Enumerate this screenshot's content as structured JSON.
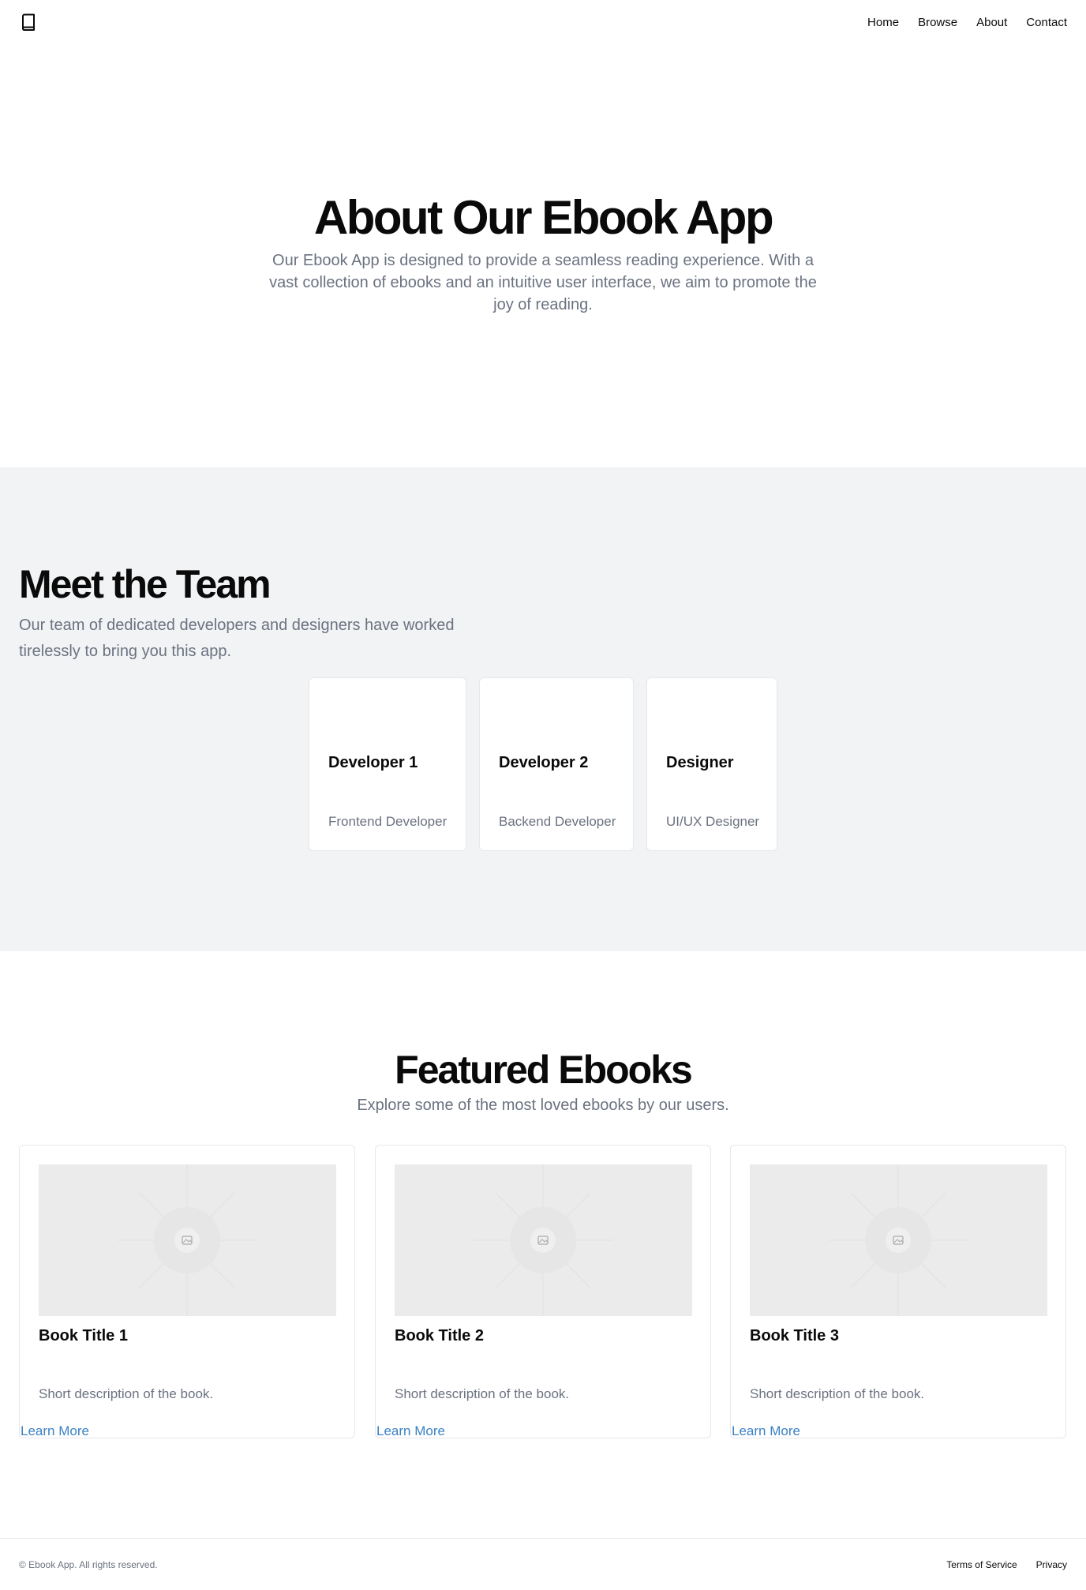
{
  "header": {
    "logo_icon": "book-icon",
    "nav": [
      "Home",
      "Browse",
      "About",
      "Contact"
    ]
  },
  "hero": {
    "title": "About Our Ebook App",
    "description": "Our Ebook App is designed to provide a seamless reading experience. With a vast collection of ebooks and an intuitive user interface, we aim to promote the joy of reading."
  },
  "team": {
    "title": "Meet the Team",
    "description": "Our team of dedicated developers and designers have worked tirelessly to bring you this app.",
    "members": [
      {
        "name": "Developer 1",
        "role": "Frontend Developer"
      },
      {
        "name": "Developer 2",
        "role": "Backend Developer"
      },
      {
        "name": "Designer",
        "role": "UI/UX Designer"
      }
    ]
  },
  "featured": {
    "title": "Featured Ebooks",
    "description": "Explore some of the most loved ebooks by our users.",
    "books": [
      {
        "title": "Book Title 1",
        "description": "Short description of the book.",
        "link": "Learn More"
      },
      {
        "title": "Book Title 2",
        "description": "Short description of the book.",
        "link": "Learn More"
      },
      {
        "title": "Book Title 3",
        "description": "Short description of the book.",
        "link": "Learn More"
      }
    ],
    "placeholder_icon": "image-placeholder-icon"
  },
  "footer": {
    "copyright": "© Ebook App. All rights reserved.",
    "links": [
      "Terms of Service",
      "Privacy"
    ]
  },
  "colors": {
    "text": "#0a0a0a",
    "muted": "#6b7280",
    "section_bg": "#f2f3f5",
    "link": "#3b82c4",
    "border": "#e5e7eb"
  }
}
